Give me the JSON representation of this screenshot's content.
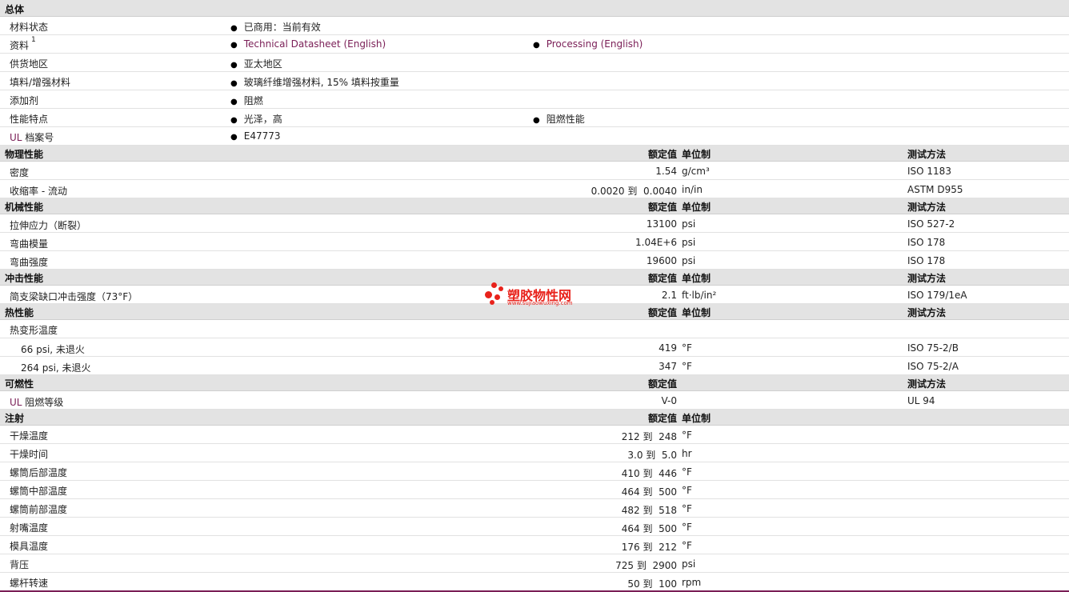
{
  "general": {
    "title": "总体",
    "status": {
      "label": "材料状态",
      "value": "已商用：当前有效"
    },
    "docs": {
      "label": "资料",
      "sup": "1",
      "link1": "Technical Datasheet (English)",
      "link2": "Processing (English)"
    },
    "region": {
      "label": "供货地区",
      "value": "亚太地区"
    },
    "filler": {
      "label": "填料/增强材料",
      "value": "玻璃纤维增强材料, 15% 填料按重量"
    },
    "additive": {
      "label": "添加剂",
      "value": "阻燃"
    },
    "features": {
      "label": "性能特点",
      "value1": "光泽，高",
      "value2": "阻燃性能"
    },
    "ul_file": {
      "label_ul": "UL",
      "label_rest": " 档案号",
      "value": "E47773"
    }
  },
  "physical": {
    "title": "物理性能",
    "h_value": "额定值",
    "h_unit": "单位制",
    "h_method": "测试方法",
    "rows": [
      {
        "label": "密度",
        "value": "1.54",
        "unit": "g/cm³",
        "method": "ISO 1183"
      },
      {
        "label": "收缩率 - 流动",
        "value": "0.0020 到  0.0040",
        "unit": "in/in",
        "method": "ASTM D955"
      }
    ]
  },
  "mechanical": {
    "title": "机械性能",
    "h_value": "额定值",
    "h_unit": "单位制",
    "h_method": "测试方法",
    "rows": [
      {
        "label": "拉伸应力（断裂）",
        "value": "13100",
        "unit": "psi",
        "method": "ISO 527-2"
      },
      {
        "label": "弯曲模量",
        "value": "1.04E+6",
        "unit": "psi",
        "method": "ISO 178"
      },
      {
        "label": "弯曲强度",
        "value": "19600",
        "unit": "psi",
        "method": "ISO 178"
      }
    ]
  },
  "impact": {
    "title": "冲击性能",
    "h_value": "额定值",
    "h_unit": "单位制",
    "h_method": "测试方法",
    "rows": [
      {
        "label": "简支梁缺口冲击强度（73°F）",
        "value": "2.1",
        "unit": "ft·lb/in²",
        "method": "ISO 179/1eA"
      }
    ]
  },
  "thermal": {
    "title": "热性能",
    "h_value": "额定值",
    "h_unit": "单位制",
    "h_method": "测试方法",
    "hdt_label": "热变形温度",
    "rows": [
      {
        "label": "66 psi, 未退火",
        "value": "419",
        "unit": "°F",
        "method": "ISO 75-2/B"
      },
      {
        "label": "264 psi, 未退火",
        "value": "347",
        "unit": "°F",
        "method": "ISO 75-2/A"
      }
    ]
  },
  "flammability": {
    "title": "可燃性",
    "h_value": "额定值",
    "h_method": "测试方法",
    "rows": [
      {
        "label_ul": "UL",
        "label_rest": " 阻燃等级",
        "value": "V-0",
        "method": "UL 94"
      }
    ]
  },
  "injection": {
    "title": "注射",
    "h_value": "额定值",
    "h_unit": "单位制",
    "rows": [
      {
        "label": "干燥温度",
        "value": "212 到  248",
        "unit": "°F"
      },
      {
        "label": "干燥时间",
        "value": "3.0 到  5.0",
        "unit": "hr"
      },
      {
        "label": "螺筒后部温度",
        "value": "410 到  446",
        "unit": "°F"
      },
      {
        "label": "螺筒中部温度",
        "value": "464 到  500",
        "unit": "°F"
      },
      {
        "label": "螺筒前部温度",
        "value": "482 到  518",
        "unit": "°F"
      },
      {
        "label": "射嘴温度",
        "value": "464 到  500",
        "unit": "°F"
      },
      {
        "label": "模具温度",
        "value": "176 到  212",
        "unit": "°F"
      },
      {
        "label": "背压",
        "value": "725 到  2900",
        "unit": "psi"
      },
      {
        "label": "螺杆转速",
        "value": "50 到  100",
        "unit": "rpm"
      }
    ]
  },
  "watermark": {
    "name": "塑胶物性网",
    "url": "www.sujiaowuxing.com"
  },
  "colors": {
    "header_bg": "#e3e3e3",
    "link": "#7a1e56",
    "watermark": "#e8221b"
  }
}
